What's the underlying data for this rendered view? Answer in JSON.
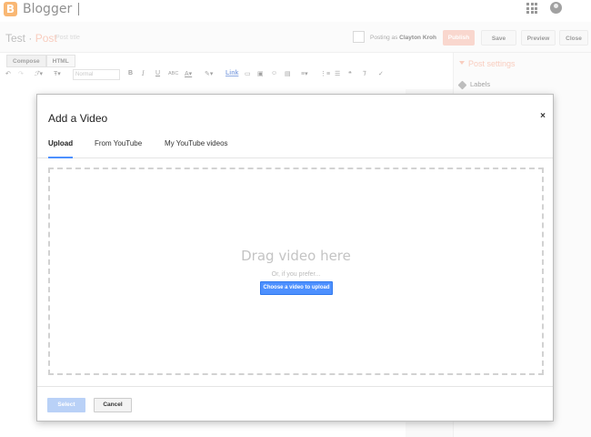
{
  "app": {
    "brand": "Blogger",
    "logo_letter": "B"
  },
  "post_header": {
    "blog_name": "Test",
    "separator": " · ",
    "post_word": "Post",
    "title_placeholder": "Post title",
    "posting_as_label": "Posting as",
    "author_name": "Clayton Kroh",
    "publish_label": "Publish",
    "save_label": "Save",
    "preview_label": "Preview",
    "close_label": "Close"
  },
  "editor": {
    "tabs": [
      "Compose",
      "HTML"
    ],
    "font_size_select": "Normal",
    "toolbar": {
      "bold": "B",
      "italic": "I",
      "underline": "U",
      "strike": "ABC",
      "link": "Link"
    }
  },
  "right_panel": {
    "title": "Post settings",
    "labels_item": "Labels"
  },
  "modal": {
    "title": "Add a Video",
    "close_glyph": "×",
    "tabs": [
      "Upload",
      "From YouTube",
      "My YouTube videos"
    ],
    "drag_text": "Drag video here",
    "prefer_text": "Or, if you prefer...",
    "choose_button": "Choose a video to upload",
    "select_label": "Select",
    "cancel_label": "Cancel"
  },
  "colors": {
    "accent_orange": "#f57d00",
    "publish_disabled": "#f4b7a6",
    "primary_blue": "#4d90fe",
    "select_disabled": "#b9d1f7"
  }
}
